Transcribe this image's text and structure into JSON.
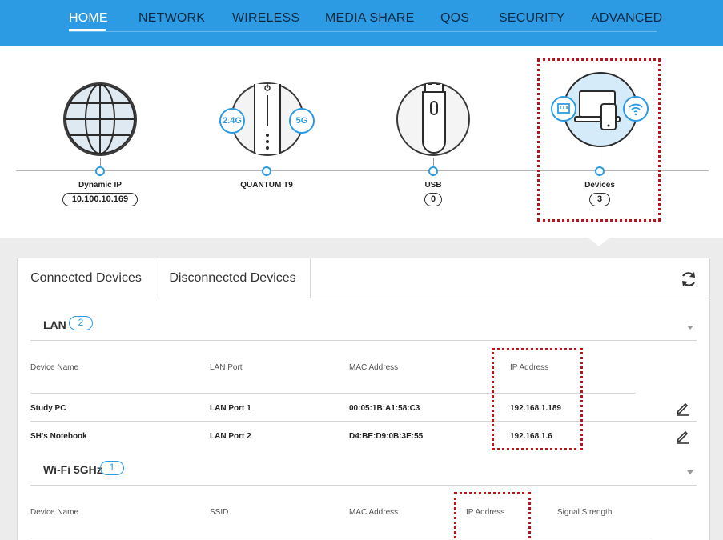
{
  "nav": {
    "items": [
      "HOME",
      "NETWORK",
      "WIRELESS",
      "MEDIA SHARE",
      "QOS",
      "SECURITY",
      "ADVANCED"
    ],
    "active": "HOME"
  },
  "topology": {
    "internet": {
      "label": "Dynamic IP",
      "value": "10.100.10.169",
      "icon": "globe-icon"
    },
    "router": {
      "label": "QUANTUM T9",
      "band_24": "2.4G",
      "band_5": "5G",
      "icon": "router-icon"
    },
    "usb": {
      "label": "USB",
      "value": "0",
      "icon": "usb-drive-icon"
    },
    "devices": {
      "label": "Devices",
      "value": "3",
      "icon": "devices-icon"
    }
  },
  "tabs": {
    "connected": "Connected Devices",
    "disconnected": "Disconnected Devices"
  },
  "lan": {
    "title": "LAN",
    "count": "2",
    "headers": [
      "Device Name",
      "LAN Port",
      "MAC Address",
      "IP Address"
    ],
    "rows": [
      {
        "name": "Study PC",
        "port": "LAN Port 1",
        "mac": "00:05:1B:A1:58:C3",
        "ip": "192.168.1.189"
      },
      {
        "name": "SH's Notebook",
        "port": "LAN Port 2",
        "mac": "D4:BE:D9:0B:3E:55",
        "ip": "192.168.1.6"
      }
    ]
  },
  "wifi5": {
    "title": "Wi-Fi 5GHz",
    "count": "1",
    "headers": [
      "Device Name",
      "SSID",
      "MAC Address",
      "IP Address",
      "Signal Strength"
    ]
  },
  "colors": {
    "accent": "#2d9be3",
    "highlight": "#c0101a"
  }
}
